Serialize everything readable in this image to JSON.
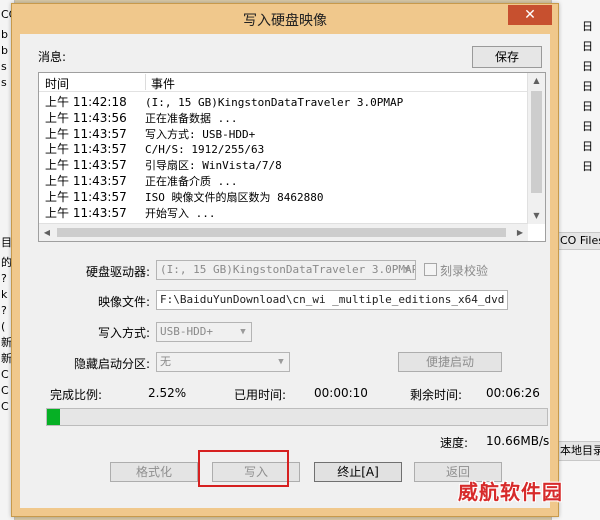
{
  "window": {
    "title": "写入硬盘映像",
    "close_glyph": "✕"
  },
  "bg_left": [
    "CC",
    "b",
    "b",
    "s",
    "s",
    "目",
    "的",
    "?",
    "k",
    "?",
    "(",
    "新",
    "新",
    "C",
    "C",
    "C"
  ],
  "bg_right": {
    "top_frags": [
      "日",
      "日",
      "日",
      "日",
      "日",
      "日",
      "日",
      "日"
    ],
    "strip1": "CO Files",
    "strip2": "本地目录"
  },
  "messages": {
    "label": "消息:",
    "save_label": "保存",
    "columns": {
      "time": "时间",
      "event": "事件"
    },
    "rows": [
      {
        "time": "上午 11:42:18",
        "event": "(I:, 15 GB)KingstonDataTraveler 3.0PMAP"
      },
      {
        "time": "上午 11:43:56",
        "event": "正在准备数据 ..."
      },
      {
        "time": "上午 11:43:57",
        "event": "写入方式: USB-HDD+"
      },
      {
        "time": "上午 11:43:57",
        "event": "C/H/S: 1912/255/63"
      },
      {
        "time": "上午 11:43:57",
        "event": "引导扇区: WinVista/7/8"
      },
      {
        "time": "上午 11:43:57",
        "event": "正在准备介质 ..."
      },
      {
        "time": "上午 11:43:57",
        "event": "ISO 映像文件的扇区数为 8462880"
      },
      {
        "time": "上午 11:43:57",
        "event": "开始写入 ..."
      }
    ]
  },
  "form": {
    "drive_label": "硬盘驱动器:",
    "drive_value": "(I:, 15 GB)KingstonDataTraveler 3.0PMAP",
    "verify_label": "刻录校验",
    "image_label": "映像文件:",
    "image_value": "F:\\BaiduYunDownload\\cn_wi                    _multiple_editions_x64_dvd",
    "write_mode_label": "写入方式:",
    "write_mode_value": "USB-HDD+",
    "hidden_label": "隐藏启动分区:",
    "hidden_value": "无",
    "quick_boot_label": "便捷启动"
  },
  "status": {
    "percent_label": "完成比例:",
    "percent_value": "2.52%",
    "progress_fraction": 0.0252,
    "elapsed_label": "已用时间:",
    "elapsed_value": "00:00:10",
    "remaining_label": "剩余时间:",
    "remaining_value": "00:06:26",
    "speed_label": "速度:",
    "speed_value": "10.66MB/s"
  },
  "buttons": {
    "format": "格式化",
    "write": "写入",
    "stop": "终止[A]",
    "back": "返回"
  },
  "watermark": "威航软件园",
  "colors": {
    "accent_frame": "#f0c88c",
    "progress": "#06b025",
    "highlight": "#d62020"
  }
}
